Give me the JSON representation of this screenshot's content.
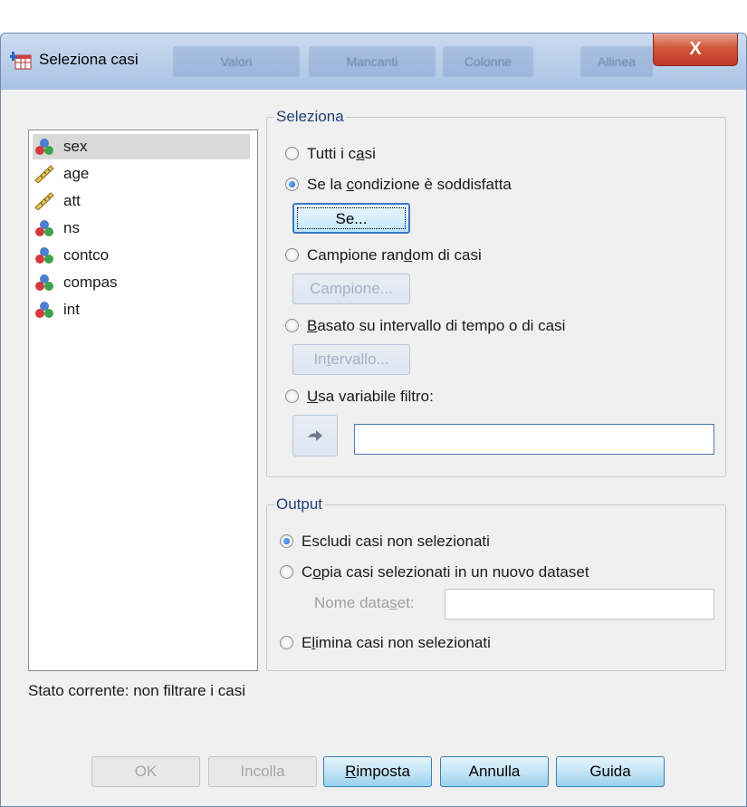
{
  "window": {
    "title": "Seleziona casi",
    "close_label": "X",
    "background_headers": [
      "Valori",
      "Mancanti",
      "Colonne",
      "Allinea"
    ]
  },
  "variables": [
    {
      "name": "sex",
      "type": "nominal",
      "icon": "nominal-icon",
      "selected": true
    },
    {
      "name": "age",
      "type": "scale",
      "icon": "ruler-icon",
      "selected": false
    },
    {
      "name": "att",
      "type": "scale",
      "icon": "ruler-icon",
      "selected": false
    },
    {
      "name": "ns",
      "type": "nominal",
      "icon": "nominal-icon",
      "selected": false
    },
    {
      "name": "contco",
      "type": "nominal",
      "icon": "nominal-icon",
      "selected": false
    },
    {
      "name": "compas",
      "type": "nominal",
      "icon": "nominal-icon",
      "selected": false
    },
    {
      "name": "int",
      "type": "nominal",
      "icon": "nominal-icon",
      "selected": false
    }
  ],
  "seleziona": {
    "title": "Seleziona",
    "all_cases": {
      "pre": "Tutti i c",
      "u": "a",
      "post": "si"
    },
    "if_condition": {
      "pre": "Se la ",
      "u": "c",
      "post": "ondizione è soddisfatta"
    },
    "if_button": "Se...",
    "random_sample": {
      "pre": "Campione ran",
      "u": "d",
      "post": "om di casi"
    },
    "sample_button": "Campione...",
    "time_range": {
      "pre": "",
      "u": "B",
      "post": "asato su intervallo di tempo o di casi"
    },
    "range_button": {
      "pre": "In",
      "u": "t",
      "post": "ervallo..."
    },
    "filter_variable": {
      "pre": "",
      "u": "U",
      "post": "sa variabile filtro:"
    },
    "filter_value": "",
    "selected_option": "if_condition"
  },
  "output": {
    "title": "Output",
    "exclude": "Escludi casi non selezionati",
    "copy": {
      "pre": "C",
      "u": "o",
      "post": "pia casi selezionati in un nuovo dataset"
    },
    "dataset_name_label": {
      "pre": "Nome data",
      "u": "s",
      "post": "et:"
    },
    "dataset_name_value": "",
    "delete": {
      "pre": "E",
      "u": "l",
      "post": "imina casi non selezionati"
    },
    "selected_option": "exclude"
  },
  "status": "Stato corrente: non filtrare i casi",
  "buttons": {
    "ok": "OK",
    "paste": "Incolla",
    "reset": {
      "pre": "",
      "u": "R",
      "post": "imposta"
    },
    "cancel": "Annulla",
    "help": "Guida"
  },
  "colors": {
    "accent": "#3a78c5",
    "group_title": "#1f3f78",
    "close": "#c0392b"
  }
}
